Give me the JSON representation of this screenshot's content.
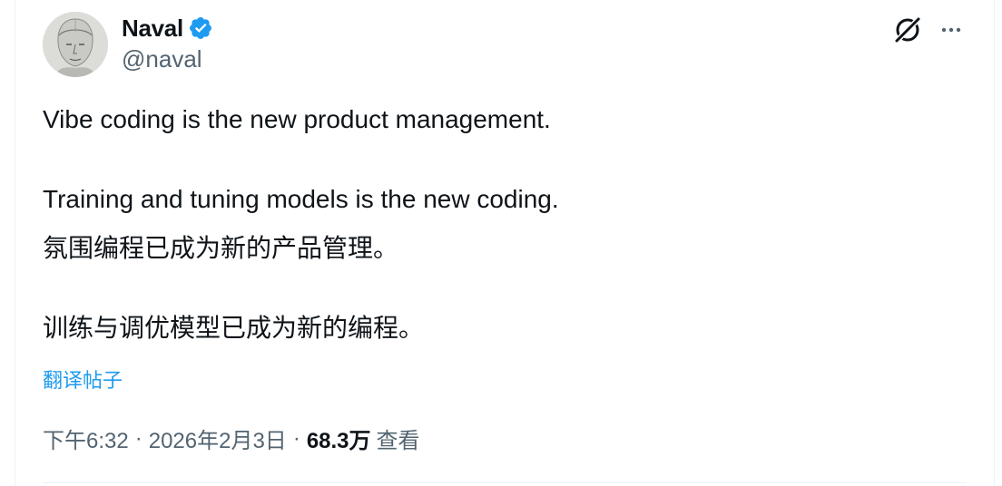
{
  "author": {
    "display_name": "Naval",
    "handle": "@naval",
    "verified": true
  },
  "header": {
    "grok_icon": "grok-icon",
    "more_icon": "more-dots-icon"
  },
  "tweet": {
    "lines": [
      "Vibe coding is the new product management.",
      "Training and tuning models is the new coding."
    ],
    "translation_lines": [
      "氛围编程已成为新的产品管理。",
      "训练与调优模型已成为新的编程。"
    ],
    "translate_label": "翻译帖子"
  },
  "meta": {
    "time": "下午6:32",
    "separator": "·",
    "date": "2026年2月3日",
    "views_count": "68.3万",
    "views_label": "查看"
  },
  "colors": {
    "accent": "#1d9bf0",
    "text": "#0f1419",
    "secondary": "#536471"
  }
}
